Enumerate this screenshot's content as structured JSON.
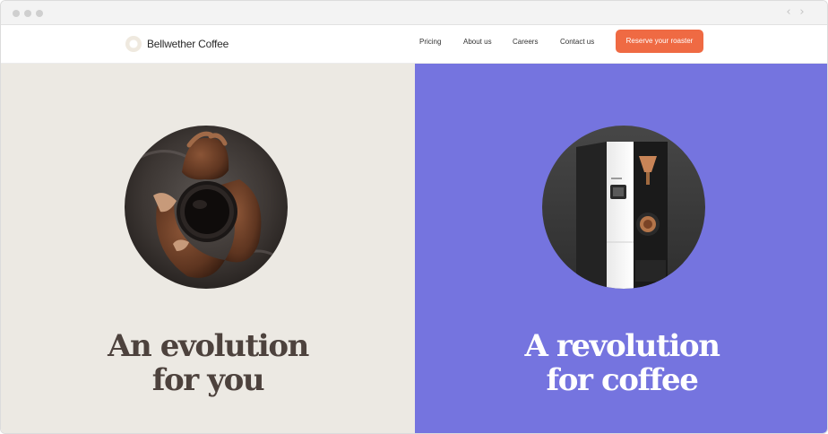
{
  "browser": {
    "back_glyph": "‹",
    "forward_glyph": "›"
  },
  "header": {
    "brand": "Bellwether Coffee",
    "logo_icon": "ring-logo-icon",
    "nav": {
      "pricing": "Pricing",
      "about": "About us",
      "careers": "Careers",
      "contact": "Contact us"
    },
    "cta_label": "Reserve your roaster",
    "cta_color": "#ef6a43"
  },
  "hero": {
    "left": {
      "background": "#ece9e3",
      "image_subject": "hands-holding-coffee-cup",
      "headline_line1": "An evolution",
      "headline_line2": "for you"
    },
    "right": {
      "background": "#7574df",
      "image_subject": "coffee-roaster-machine",
      "headline_line1": "A revolution",
      "headline_line2": "for coffee"
    }
  }
}
